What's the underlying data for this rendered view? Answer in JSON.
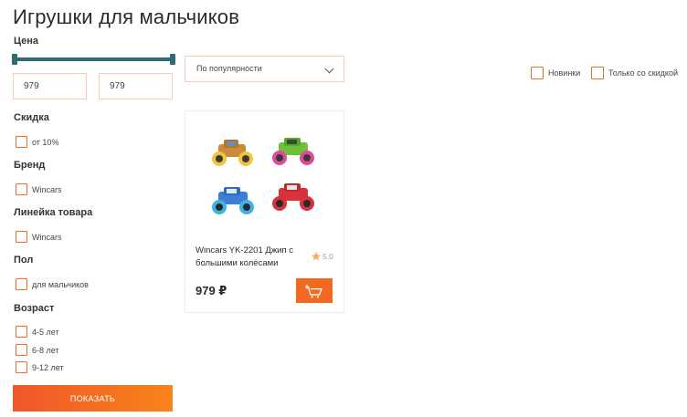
{
  "page": {
    "title": "Игрушки для мальчиков"
  },
  "filters": {
    "price": {
      "heading": "Цена",
      "min_value": "979",
      "max_value": "979",
      "range_fill": 1.0
    },
    "discount": {
      "heading": "Скидка",
      "options": [
        {
          "label": "от 10%",
          "checked": false
        }
      ]
    },
    "brand": {
      "heading": "Бренд",
      "options": [
        {
          "label": "Wincars",
          "checked": false
        }
      ]
    },
    "product_line": {
      "heading": "Линейка товара",
      "options": [
        {
          "label": "Wincars",
          "checked": false
        }
      ]
    },
    "gender": {
      "heading": "Пол",
      "options": [
        {
          "label": "для мальчиков",
          "checked": false
        }
      ]
    },
    "age": {
      "heading": "Возраст",
      "options": [
        {
          "label": "4-5 лет",
          "checked": false
        },
        {
          "label": "6-8 лет",
          "checked": false
        },
        {
          "label": "9-12 лет",
          "checked": false
        }
      ]
    },
    "apply_label": "ПОКАЗАТЬ"
  },
  "toolbar": {
    "sort_selected": "По популярности",
    "new_label": "Новинки",
    "discount_only_label": "Только со скидкой"
  },
  "products": [
    {
      "name": "Wincars YK-2201 Джип с большими колёсами",
      "rating": "5.0",
      "price": "979 ₽",
      "cart_icon": "cart-plus-icon"
    }
  ],
  "colors": {
    "accent": "#f26a21",
    "slider": "#2f6b73",
    "checkbox_border": "#ef6b2c",
    "star": "#f5a962"
  }
}
